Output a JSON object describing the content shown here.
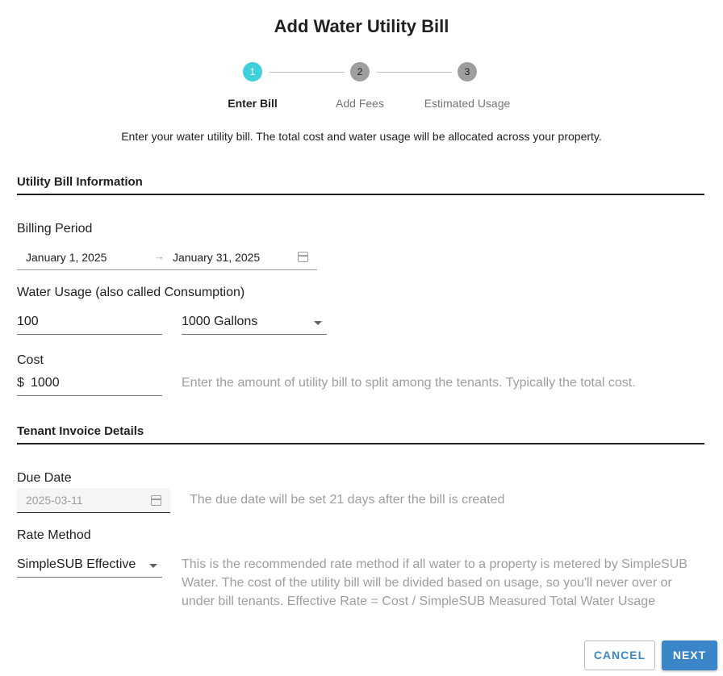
{
  "title": "Add Water Utility Bill",
  "steps": [
    {
      "number": "1",
      "label": "Enter Bill"
    },
    {
      "number": "2",
      "label": "Add Fees"
    },
    {
      "number": "3",
      "label": "Estimated Usage"
    }
  ],
  "intro": "Enter your water utility bill. The total cost and water usage will be allocated across your property.",
  "bill_section": {
    "heading": "Utility Bill Information",
    "billing_period_label": "Billing Period",
    "start_date": "January 1, 2025",
    "arrow": "→",
    "end_date": "January 31, 2025",
    "usage_label": "Water Usage (also called Consumption)",
    "usage_value": "100",
    "usage_unit": "1000 Gallons",
    "cost_label": "Cost",
    "cost_prefix": "$",
    "cost_value": "1000",
    "cost_hint": "Enter the amount of utility bill to split among the tenants. Typically the total cost."
  },
  "invoice_section": {
    "heading": "Tenant Invoice Details",
    "due_date_label": "Due Date",
    "due_date_value": "2025-03-11",
    "due_date_hint": "The due date will be set 21 days after the bill is created",
    "rate_method_label": "Rate Method",
    "rate_method_value": "SimpleSUB Effective",
    "rate_method_hint": "This is the recommended rate method if all water to a property is metered by SimpleSUB Water. The cost of the utility bill will be divided based on usage, so you'll never over or under bill tenants. Effective Rate = Cost / SimpleSUB Measured Total Water Usage"
  },
  "actions": {
    "cancel_label": "CANCEL",
    "next_label": "NEXT"
  },
  "colors": {
    "active_step": "#40d0dc",
    "inactive_step": "#9e9e9e",
    "primary": "#3a86c8"
  }
}
